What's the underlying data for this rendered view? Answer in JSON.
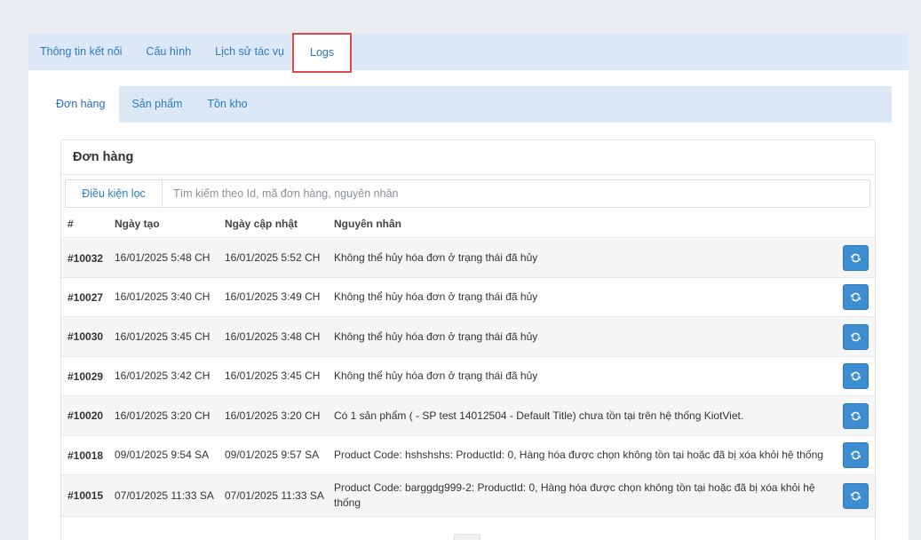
{
  "top_tabs": [
    {
      "label": "Thông tin kết nối"
    },
    {
      "label": "Cấu hình"
    },
    {
      "label": "Lịch sử tác vụ"
    },
    {
      "label": "Logs"
    }
  ],
  "sub_tabs": [
    {
      "label": "Đơn hàng"
    },
    {
      "label": "Sản phẩm"
    },
    {
      "label": "Tồn kho"
    }
  ],
  "card": {
    "title": "Đơn hàng",
    "filter_label": "Điều kiện lọc",
    "search_placeholder": "Tìm kiếm theo Id, mã đơn hàng, nguyên nhân"
  },
  "table": {
    "headers": {
      "id": "#",
      "created": "Ngày tạo",
      "updated": "Ngày cập nhật",
      "reason": "Nguyên nhân"
    },
    "rows": [
      {
        "id": "#10032",
        "created": "16/01/2025 5:48 CH",
        "updated": "16/01/2025 5:52 CH",
        "reason": "Không thể hủy hóa đơn ở trạng thái đã hủy"
      },
      {
        "id": "#10027",
        "created": "16/01/2025 3:40 CH",
        "updated": "16/01/2025 3:49 CH",
        "reason": "Không thể hủy hóa đơn ở trạng thái đã hủy"
      },
      {
        "id": "#10030",
        "created": "16/01/2025 3:45 CH",
        "updated": "16/01/2025 3:48 CH",
        "reason": "Không thể hủy hóa đơn ở trạng thái đã hủy"
      },
      {
        "id": "#10029",
        "created": "16/01/2025 3:42 CH",
        "updated": "16/01/2025 3:45 CH",
        "reason": "Không thể hủy hóa đơn ở trạng thái đã hủy"
      },
      {
        "id": "#10020",
        "created": "16/01/2025 3:20 CH",
        "updated": "16/01/2025 3:20 CH",
        "reason": "Có 1 sản phẩm ( - SP test 14012504 - Default Title) chưa tồn tại trên hệ thống KiotViet."
      },
      {
        "id": "#10018",
        "created": "09/01/2025 9:54 SA",
        "updated": "09/01/2025 9:57 SA",
        "reason": "Product Code: hshshshs: ProductId: 0, Hàng hóa được chọn không tồn tại hoặc đã bị xóa khỏi hệ thống"
      },
      {
        "id": "#10015",
        "created": "07/01/2025 11:33 SA",
        "updated": "07/01/2025 11:33 SA",
        "reason": "Product Code: barggdg999-2: ProductId: 0, Hàng hóa được chọn không tồn tại hoặc đã bị xóa khỏi hệ thống"
      }
    ],
    "row_action_icon": "refresh-icon"
  },
  "colors": {
    "accent": "#3c8dd1",
    "tab_bar": "#dce8f6",
    "highlight_border": "#e04a4a"
  }
}
